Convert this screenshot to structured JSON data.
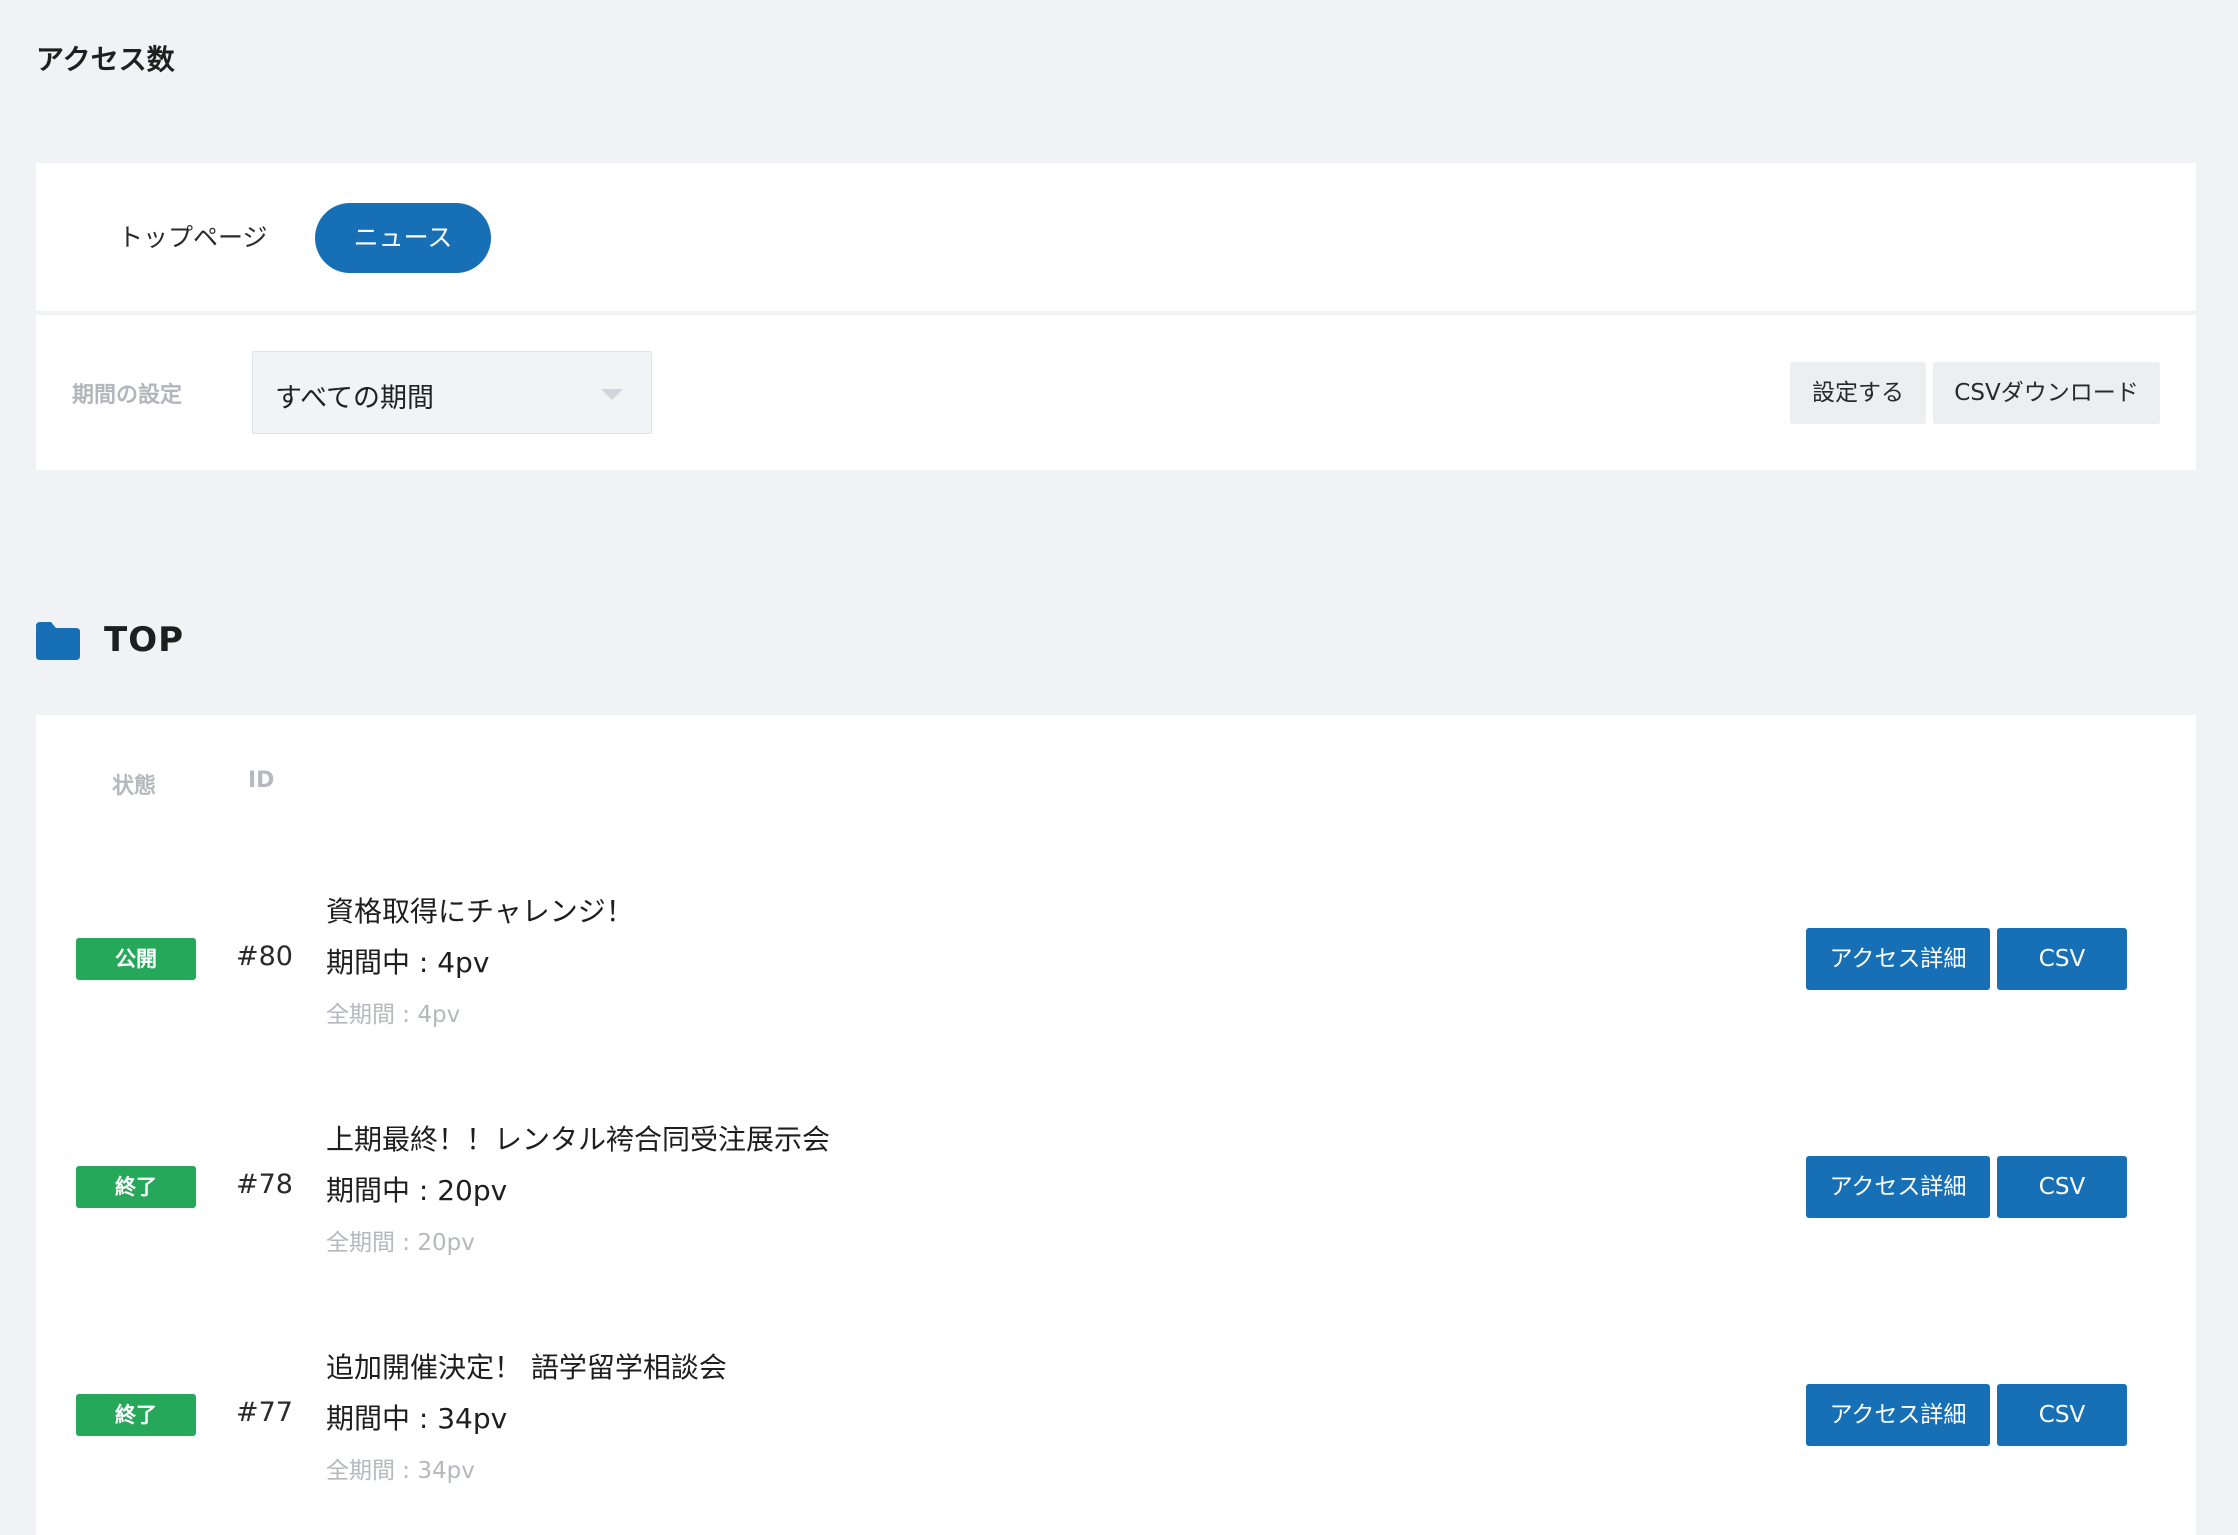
{
  "page": {
    "title": "アクセス数"
  },
  "tabs": [
    {
      "label": "トップページ",
      "active": false
    },
    {
      "label": "ニュース",
      "active": true
    }
  ],
  "period": {
    "label": "期間の設定",
    "selected": "すべての期間",
    "set_button": "設定する",
    "csv_download_button": "CSVダウンロード"
  },
  "section": {
    "title": "TOP",
    "icon": "folder-icon"
  },
  "table": {
    "headers": {
      "state": "状態",
      "id": "ID"
    },
    "rows": [
      {
        "status": "公開",
        "id": "#80",
        "title": "資格取得にチャレンジ！",
        "period_views": "期間中 : 4pv",
        "total_views": "全期間 : 4pv",
        "detail_button": "アクセス詳細",
        "csv_button": "CSV"
      },
      {
        "status": "終了",
        "id": "#78",
        "title": "上期最終！！レンタル袴合同受注展示会",
        "period_views": "期間中 : 20pv",
        "total_views": "全期間 : 20pv",
        "detail_button": "アクセス詳細",
        "csv_button": "CSV"
      },
      {
        "status": "終了",
        "id": "#77",
        "title": "追加開催決定！ 語学留学相談会",
        "period_views": "期間中 : 34pv",
        "total_views": "全期間 : 34pv",
        "detail_button": "アクセス詳細",
        "csv_button": "CSV"
      }
    ]
  },
  "colors": {
    "primary": "#1770b5",
    "status_green": "#26a85a",
    "background": "#f0f2f5"
  }
}
